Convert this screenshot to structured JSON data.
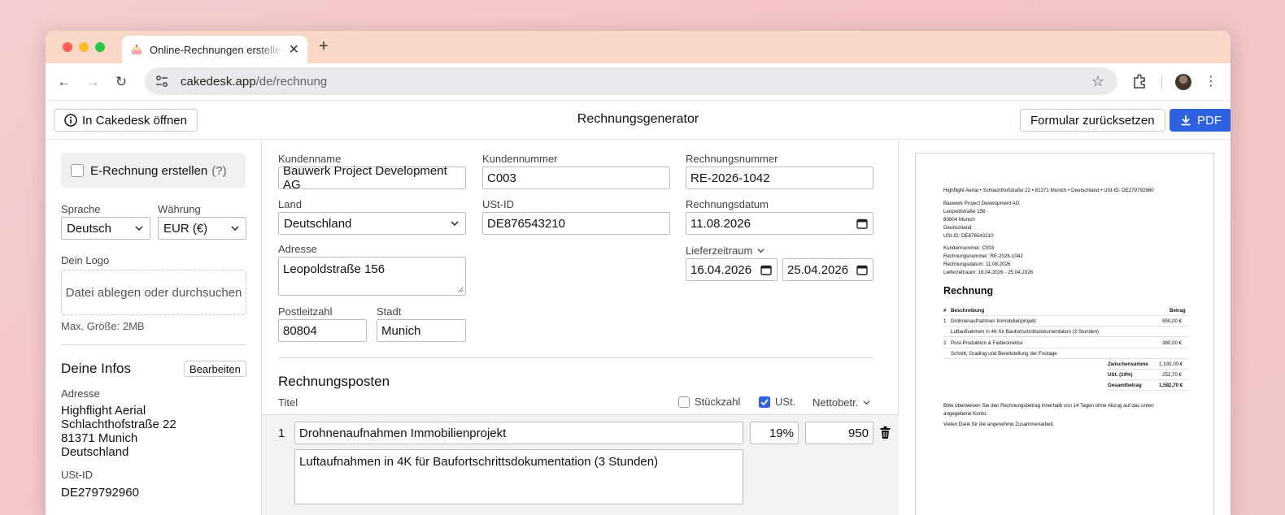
{
  "browser": {
    "tab_title": "Online-Rechnungen erstellen",
    "url_host": "cakedesk.app",
    "url_path": "/de/rechnung"
  },
  "header": {
    "open_label": "In Cakedesk öffnen",
    "title": "Rechnungsgenerator",
    "reset_label": "Formular zurücksetzen",
    "pdf_label": "PDF",
    "accent": "#2f62e0"
  },
  "sidebar": {
    "erechnung_label": "E-Rechnung erstellen",
    "erechnung_help": "(?)",
    "language_label": "Sprache",
    "language_value": "Deutsch",
    "currency_label": "Währung",
    "currency_value": "EUR (€)",
    "logo_label": "Dein Logo",
    "logo_drop": "Datei ablegen oder durchsuchen",
    "logo_max": "Max. Größe: 2MB",
    "info_title": "Deine Infos",
    "edit_label": "Bearbeiten",
    "address_label": "Adresse",
    "address_lines": [
      "Highflight Aerial",
      "Schlachthofstraße 22",
      "81371 Munich",
      "Deutschland"
    ],
    "vat_label": "USt-ID",
    "vat_value": "DE279792960"
  },
  "form": {
    "customer_name_label": "Kundenname",
    "customer_name_value": "Bauwerk Project Development AG",
    "customer_number_label": "Kundennummer",
    "customer_number_value": "C003",
    "invoice_number_label": "Rechnungsnummer",
    "invoice_number_value": "RE-2026-1042",
    "country_label": "Land",
    "country_value": "Deutschland",
    "vat_label": "USt-ID",
    "vat_value": "DE876543210",
    "invoice_date_label": "Rechnungsdatum",
    "invoice_date_value": "11.08.2026",
    "address_label": "Adresse",
    "address_value": "Leopoldstraße 156",
    "period_label": "Lieferzeitraum",
    "period_from": "16.04.2026",
    "period_to": "25.04.2026",
    "zip_label": "Postleitzahl",
    "zip_value": "80804",
    "city_label": "Stadt",
    "city_value": "Munich"
  },
  "positions": {
    "title": "Rechnungsposten",
    "col_title": "Titel",
    "col_qty": "Stückzahl",
    "col_vat": "USt.",
    "col_net": "Nettobetr.",
    "qty_checked": false,
    "vat_checked": true,
    "items": [
      {
        "index": "1",
        "title": "Drohnenaufnahmen Immobilienprojekt",
        "description": "Luftaufnahmen in 4K für Baufortschrittsdokumentation (3 Stunden)",
        "vat": "19%",
        "net": "950"
      }
    ]
  },
  "preview": {
    "sender_line": "Highflight Aerial • Schlachthofstraße 22 • 81371 Munich • Deutschland • USt-ID: DE279792960",
    "recipient": [
      "Bauwerk Project Development AG",
      "Leopoldstraße 156",
      "80804 Munich",
      "Deutschland",
      "USt-ID: DE876543210"
    ],
    "meta": [
      "Kundennummer: C003",
      "Rechnungsnummer: RE-2026-1042",
      "Rechnungsdatum: 11.08.2026",
      "Lieferzeitraum: 16.04.2026 - 25.04.2026"
    ],
    "heading": "Rechnung",
    "col_hash": "#",
    "col_desc": "Beschreibung",
    "col_amount": "Betrag",
    "rows": [
      {
        "n": "1",
        "title": "Drohnenaufnahmen Immobilienprojekt",
        "amount": "950,00 €",
        "desc": "Luftaufnahmen in 4K für Baufortschrittsdokumentation (3 Stunden)"
      },
      {
        "n": "2",
        "title": "Post-Produktion & Farbkorrektur",
        "amount": "380,00 €",
        "desc": "Schnitt, Grading und Bereitstellung der Footage"
      }
    ],
    "subtotal_label": "Zwischensumme",
    "subtotal": "1.330,00 €",
    "tax_label": "USt. (19%)",
    "tax": "252,70 €",
    "total_label": "Gesamtbetrag",
    "total": "1.582,70 €",
    "payment_note_1": "Bitte überweisen Sie den Rechnungsbetrag innerhalb von 14 Tagen ohne Abzug auf das unten",
    "payment_note_2": "angegebene Konto.",
    "thanks": "Vielen Dank für die angenehme Zusammenarbeit."
  }
}
